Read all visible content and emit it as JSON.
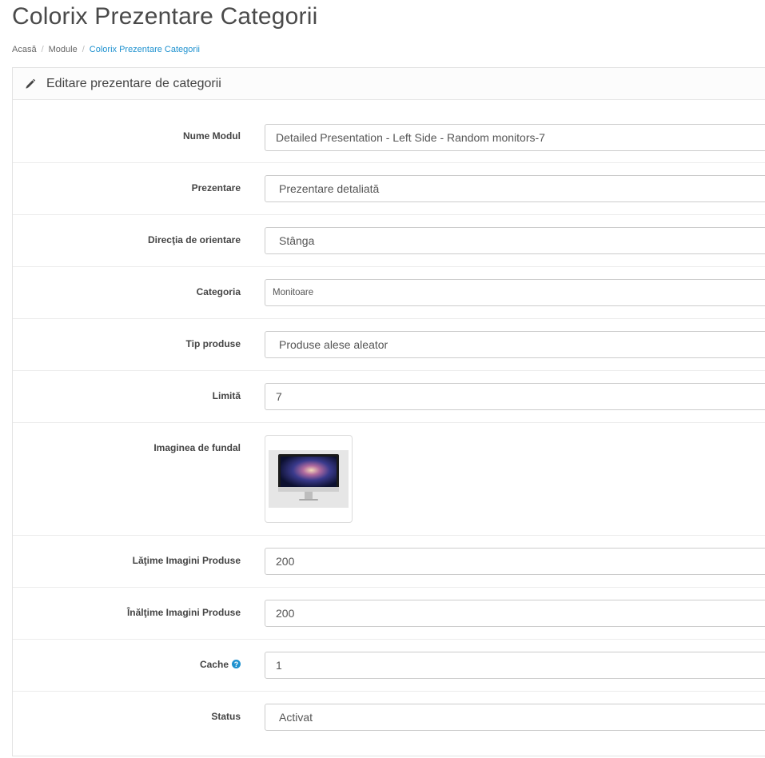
{
  "page": {
    "title": "Colorix Prezentare Categorii"
  },
  "breadcrumb": {
    "items": [
      "Acasă",
      "Module",
      "Colorix Prezentare Categorii"
    ]
  },
  "panel": {
    "heading_icon": "pencil-icon",
    "heading": "Editare prezentare de categorii"
  },
  "form": {
    "module_name": {
      "label": "Nume Modul",
      "value": "Detailed Presentation - Left Side - Random monitors-7"
    },
    "presentation": {
      "label": "Prezentare",
      "value": "Prezentare detaliată"
    },
    "orientation": {
      "label": "Direcţia de orientare",
      "value": "Stânga"
    },
    "category": {
      "label": "Categoria",
      "value": "Monitoare"
    },
    "product_type": {
      "label": "Tip produse",
      "value": "Produse alese aleator"
    },
    "limit": {
      "label": "Limită",
      "value": "7"
    },
    "background_image": {
      "label": "Imaginea de fundal",
      "image": "monitor-thumbnail"
    },
    "image_width": {
      "label": "Lăţime Imagini Produse",
      "value": "200"
    },
    "image_height": {
      "label": "Înălţime Imagini Produse",
      "value": "200"
    },
    "cache": {
      "label": "Cache",
      "value": "1",
      "help_icon": "question-circle-icon"
    },
    "status": {
      "label": "Status",
      "value": "Activat"
    }
  },
  "colors": {
    "link": "#1e91cf",
    "border": "#cccccc",
    "text": "#555555"
  }
}
